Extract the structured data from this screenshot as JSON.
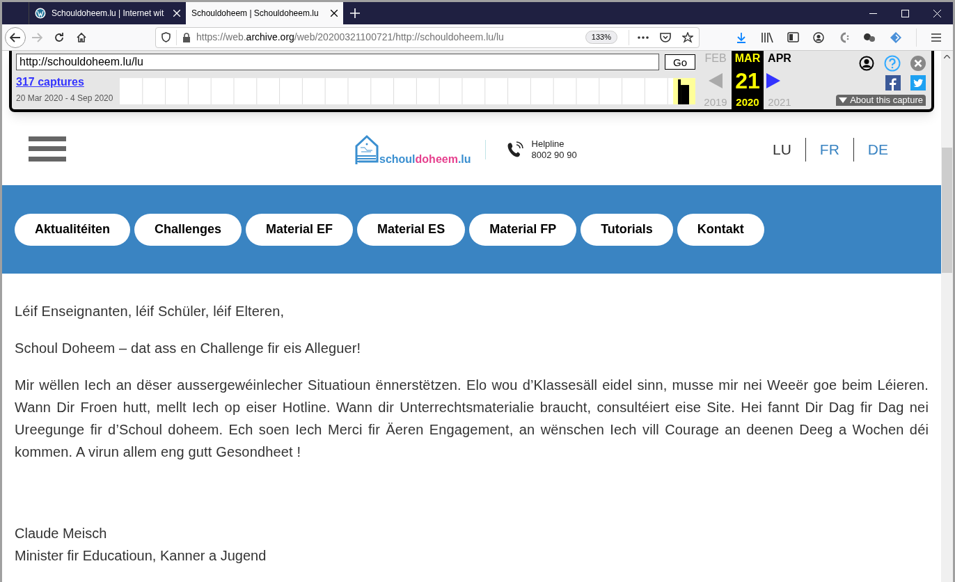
{
  "browser": {
    "tabs": [
      {
        "title": "Schouldoheem.lu | Internet wit",
        "selected": false
      },
      {
        "title": "Schouldoheem | Schouldoheem.lu",
        "selected": true
      }
    ],
    "url": {
      "prefix": "https://web.",
      "domain": "archive.org",
      "rest": "/web/20200321100721/http://schouldoheem.lu/lu"
    },
    "zoom": "133%"
  },
  "wayback": {
    "url_value": "http://schouldoheem.lu/lu",
    "go": "Go",
    "captures": "317 captures",
    "range": "20 Mar 2020 - 4 Sep 2020",
    "months": [
      {
        "label": "FEB",
        "year": "2019",
        "selected": false
      },
      {
        "label": "MAR",
        "year": "2020",
        "selected": true
      },
      {
        "label": "APR",
        "year": "2021",
        "selected": false
      }
    ],
    "day": "21",
    "about": "About this capture"
  },
  "site": {
    "logo": [
      {
        "text": "schoul",
        "color": "#3a8fd0"
      },
      {
        "text": "doheem",
        "color": "#e6408e"
      },
      {
        "text": ".lu",
        "color": "#3a8fd0"
      }
    ],
    "helpline": {
      "label": "Helpline",
      "number": "8002 90 90"
    },
    "languages": [
      {
        "label": "LU",
        "selected": true
      },
      {
        "label": "FR",
        "selected": false
      },
      {
        "label": "DE",
        "selected": false
      }
    ],
    "nav": [
      "Aktualitéiten",
      "Challenges",
      "Material EF",
      "Material ES",
      "Material FP",
      "Tutorials",
      "Kontakt"
    ],
    "paragraphs": [
      "Léif Enseignanten, léif Schüler, léif Elteren,",
      "Schoul Doheem – dat ass en Challenge fir eis Alleguer!",
      "Mir wëllen Iech an dëser aussergewéinlecher Situatioun ënnerstëtzen. Elo wou d’Klassesäll eidel sinn, musse mir nei Weeër goe beim Léieren.  Wann Dir Froen hutt, mellt Iech op eiser Hotline. Wann dir Unterrechtsmaterialie braucht, consultéiert eise Site. Hei fannt Dir Dag fir Dag nei Ureegunge fir d’Schoul doheem. Ech soen Iech Merci fir Äeren Engagement, an wënschen Iech vill Courage an deenen Deeg a Wochen déi kommen. A virun allem eng gutt Gesondheet !"
    ],
    "signature": [
      "Claude Meisch",
      "Minister fir Educatioun, Kanner a Jugend"
    ]
  }
}
